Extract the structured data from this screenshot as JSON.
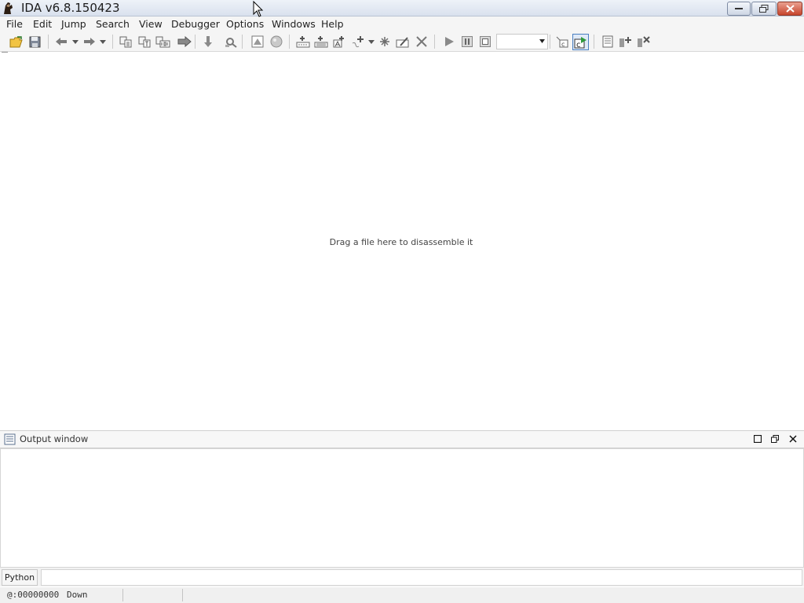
{
  "window": {
    "title": "IDA v6.8.150423"
  },
  "menu": {
    "items": [
      {
        "label": "File"
      },
      {
        "label": "Edit"
      },
      {
        "label": "Jump"
      },
      {
        "label": "Search"
      },
      {
        "label": "View"
      },
      {
        "label": "Debugger"
      },
      {
        "label": "Options"
      },
      {
        "label": "Windows"
      },
      {
        "label": "Help"
      }
    ]
  },
  "toolbar": {
    "debugger_select_value": "",
    "icons": [
      "open-file-icon",
      "save-icon",
      "back-icon",
      "forward-icon",
      "xrefs-icon",
      "text-search-icon",
      "binary-search-icon",
      "jump-icon",
      "down-icon",
      "search-next-icon",
      "graph-icon",
      "circle-icon",
      "make-code-icon",
      "make-data-icon",
      "make-ascii-icon",
      "make-array-icon",
      "undefine-icon",
      "rename-icon",
      "delete-icon",
      "run-icon",
      "pause-icon",
      "stop-icon",
      "attach-icon",
      "decompile-icon",
      "structures-icon",
      "add-breakpoint-icon",
      "delete-breakpoint-icon"
    ]
  },
  "main": {
    "drop_hint": "Drag a file here to disassemble it"
  },
  "output": {
    "title": "Output window",
    "content": ""
  },
  "command": {
    "language": "Python",
    "value": ""
  },
  "status": {
    "address": "@:00000000",
    "direction": "Down",
    "message": ""
  },
  "colors": {
    "accent": "#4a7fc0",
    "close_button": "#c6452d"
  }
}
